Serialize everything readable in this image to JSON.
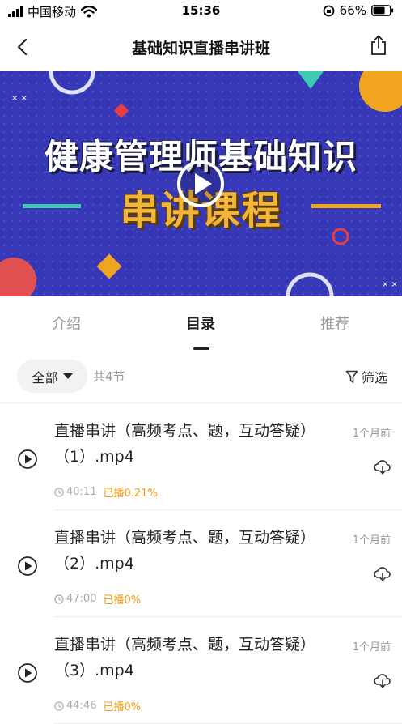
{
  "status_bar": {
    "carrier": "中国移动",
    "time": "15:36",
    "battery": "66%"
  },
  "header": {
    "title": "基础知识直播串讲班",
    "back_icon": "chevron-left-icon",
    "share_icon": "share-icon"
  },
  "banner": {
    "line1": "健康管理师基础知识",
    "line2": "串讲课程",
    "play_icon": "play-circle-icon"
  },
  "tabs": [
    {
      "label": "介绍",
      "active": false
    },
    {
      "label": "目录",
      "active": true
    },
    {
      "label": "推荐",
      "active": false
    }
  ],
  "toolbar": {
    "filter_all": "全部",
    "count": "共4节",
    "filter_label": "筛选"
  },
  "lessons": [
    {
      "title": "直播串讲（高频考点、题，互动答疑）（1）.mp4",
      "age": "1个月前",
      "duration": "40:11",
      "progress": "已播0.21%"
    },
    {
      "title": "直播串讲（高频考点、题，互动答疑）（2）.mp4",
      "age": "1个月前",
      "duration": "47:00",
      "progress": "已播0%"
    },
    {
      "title": "直播串讲（高频考点、题，互动答疑）（3）.mp4",
      "age": "1个月前",
      "duration": "44:46",
      "progress": "已播0%"
    }
  ],
  "colors": {
    "accent_orange": "#f39a14",
    "banner_bg": "#3638b8",
    "banner_gold": "#f3b43a"
  }
}
